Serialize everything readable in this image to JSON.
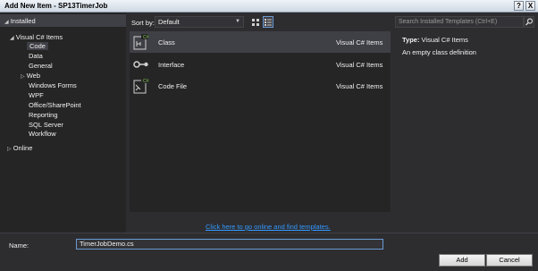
{
  "window": {
    "title": "Add New Item - SP13TimerJob",
    "help_label": "?",
    "close_label": "X"
  },
  "sidebar": {
    "installed_label": "Installed",
    "root_label": "Visual C# Items",
    "items": [
      {
        "label": "Code",
        "selected": true
      },
      {
        "label": "Data"
      },
      {
        "label": "General"
      },
      {
        "label": "Web",
        "expandable": true
      },
      {
        "label": "Windows Forms"
      },
      {
        "label": "WPF"
      },
      {
        "label": "Office/SharePoint"
      },
      {
        "label": "Reporting"
      },
      {
        "label": "SQL Server"
      },
      {
        "label": "Workflow"
      }
    ],
    "online_label": "Online"
  },
  "toolbar": {
    "sort_label": "Sort by:",
    "sort_value": "Default",
    "search_placeholder": "Search Installed Templates (Ctrl+E)"
  },
  "templates": [
    {
      "name": "Class",
      "language": "Visual C# Items",
      "icon": "class-icon"
    },
    {
      "name": "Interface",
      "language": "Visual C# Items",
      "icon": "interface-icon"
    },
    {
      "name": "Code File",
      "language": "Visual C# Items",
      "icon": "code-file-icon"
    }
  ],
  "details": {
    "type_label": "Type:",
    "type_value": "Visual C# Items",
    "description": "An empty class definition"
  },
  "online_link": "Click here to go online and find templates.",
  "form": {
    "name_label": "Name:",
    "name_value": "TimerJobDemo.cs"
  },
  "buttons": {
    "add": "Add",
    "cancel": "Cancel"
  },
  "colors": {
    "background": "#2d2d30",
    "panel": "#252526",
    "selection": "#3f3f46",
    "link": "#3399ff",
    "accent_green": "#7fc54a"
  }
}
